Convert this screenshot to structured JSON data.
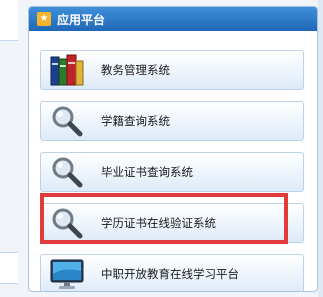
{
  "panel": {
    "title": "应用平台",
    "items": [
      {
        "label": "教务管理系统",
        "icon": "books-icon"
      },
      {
        "label": "学籍查询系统",
        "icon": "magnifier-icon"
      },
      {
        "label": "毕业证书查询系统",
        "icon": "magnifier-icon"
      },
      {
        "label": "学历证书在线验证系统",
        "icon": "magnifier-icon"
      },
      {
        "label": "中职开放教育在线学习平台",
        "icon": "monitor-icon"
      }
    ]
  },
  "colors": {
    "header": "#1f68b7",
    "highlight": "#e23b3b",
    "star": "#f7b52a"
  }
}
